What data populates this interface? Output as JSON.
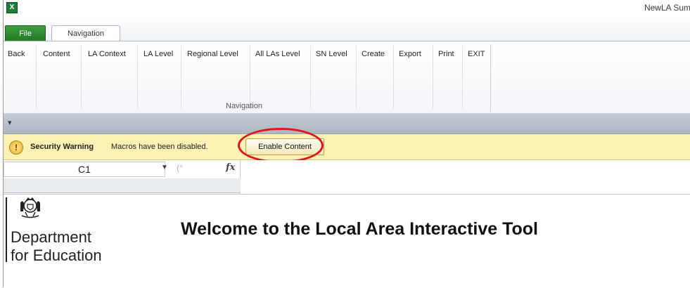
{
  "window": {
    "title": "NewLA Sum",
    "app_icon": "excel-icon"
  },
  "tabs": {
    "file": "File",
    "navigation": "Navigation"
  },
  "ribbon": {
    "buttons": [
      "Back",
      "Content",
      "LA Context",
      "LA Level",
      "Regional Level",
      "All LAs Level",
      "SN Level",
      "Create",
      "Export",
      "Print",
      "EXIT"
    ],
    "group_label": "Navigation"
  },
  "quick_access": {
    "icon": "customize-arrow-icon"
  },
  "security": {
    "title": "Security Warning",
    "message": "Macros have been disabled.",
    "button": "Enable Content"
  },
  "formula_bar": {
    "name_box": "C1",
    "fx_label": "fx"
  },
  "sheet": {
    "logo_line1": "Department",
    "logo_line2": "for Education",
    "heading": "Welcome to the Local Area Interactive Tool"
  },
  "colors": {
    "file_tab": "#2f8a2f",
    "security_bar": "#fcf2b3",
    "highlight": "#e0141e"
  }
}
